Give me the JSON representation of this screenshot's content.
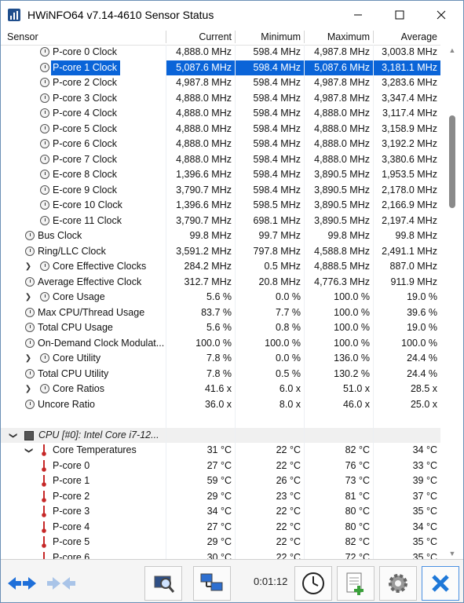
{
  "window": {
    "title": "HWiNFO64 v7.14-4610 Sensor Status"
  },
  "header": {
    "sensor": "Sensor",
    "current": "Current",
    "minimum": "Minimum",
    "maximum": "Maximum",
    "average": "Average"
  },
  "rows": [
    {
      "name": "P-core 0 Clock",
      "cur": "4,888.0 MHz",
      "min": "598.4 MHz",
      "max": "4,987.8 MHz",
      "avg": "3,003.8 MHz"
    },
    {
      "name": "P-core 1 Clock",
      "cur": "5,087.6 MHz",
      "min": "598.4 MHz",
      "max": "5,087.6 MHz",
      "avg": "3,181.1 MHz"
    },
    {
      "name": "P-core 2 Clock",
      "cur": "4,987.8 MHz",
      "min": "598.4 MHz",
      "max": "4,987.8 MHz",
      "avg": "3,283.6 MHz"
    },
    {
      "name": "P-core 3 Clock",
      "cur": "4,888.0 MHz",
      "min": "598.4 MHz",
      "max": "4,987.8 MHz",
      "avg": "3,347.4 MHz"
    },
    {
      "name": "P-core 4 Clock",
      "cur": "4,888.0 MHz",
      "min": "598.4 MHz",
      "max": "4,888.0 MHz",
      "avg": "3,117.4 MHz"
    },
    {
      "name": "P-core 5 Clock",
      "cur": "4,888.0 MHz",
      "min": "598.4 MHz",
      "max": "4,888.0 MHz",
      "avg": "3,158.9 MHz"
    },
    {
      "name": "P-core 6 Clock",
      "cur": "4,888.0 MHz",
      "min": "598.4 MHz",
      "max": "4,888.0 MHz",
      "avg": "3,192.2 MHz"
    },
    {
      "name": "P-core 7 Clock",
      "cur": "4,888.0 MHz",
      "min": "598.4 MHz",
      "max": "4,888.0 MHz",
      "avg": "3,380.6 MHz"
    },
    {
      "name": "E-core 8 Clock",
      "cur": "1,396.6 MHz",
      "min": "598.4 MHz",
      "max": "3,890.5 MHz",
      "avg": "1,953.5 MHz"
    },
    {
      "name": "E-core 9 Clock",
      "cur": "3,790.7 MHz",
      "min": "598.4 MHz",
      "max": "3,890.5 MHz",
      "avg": "2,178.0 MHz"
    },
    {
      "name": "E-core 10 Clock",
      "cur": "1,396.6 MHz",
      "min": "598.5 MHz",
      "max": "3,890.5 MHz",
      "avg": "2,166.9 MHz"
    },
    {
      "name": "E-core 11 Clock",
      "cur": "3,790.7 MHz",
      "min": "698.1 MHz",
      "max": "3,890.5 MHz",
      "avg": "2,197.4 MHz"
    },
    {
      "name": "Bus Clock",
      "cur": "99.8 MHz",
      "min": "99.7 MHz",
      "max": "99.8 MHz",
      "avg": "99.8 MHz"
    },
    {
      "name": "Ring/LLC Clock",
      "cur": "3,591.2 MHz",
      "min": "797.8 MHz",
      "max": "4,588.8 MHz",
      "avg": "2,491.1 MHz"
    },
    {
      "name": "Core Effective Clocks",
      "cur": "284.2 MHz",
      "min": "0.5 MHz",
      "max": "4,888.5 MHz",
      "avg": "887.0 MHz"
    },
    {
      "name": "Average Effective Clock",
      "cur": "312.7 MHz",
      "min": "20.8 MHz",
      "max": "4,776.3 MHz",
      "avg": "911.9 MHz"
    },
    {
      "name": "Core Usage",
      "cur": "5.6 %",
      "min": "0.0 %",
      "max": "100.0 %",
      "avg": "19.0 %"
    },
    {
      "name": "Max CPU/Thread Usage",
      "cur": "83.7 %",
      "min": "7.7 %",
      "max": "100.0 %",
      "avg": "39.6 %"
    },
    {
      "name": "Total CPU Usage",
      "cur": "5.6 %",
      "min": "0.8 %",
      "max": "100.0 %",
      "avg": "19.0 %"
    },
    {
      "name": "On-Demand Clock Modulat...",
      "cur": "100.0 %",
      "min": "100.0 %",
      "max": "100.0 %",
      "avg": "100.0 %"
    },
    {
      "name": "Core Utility",
      "cur": "7.8 %",
      "min": "0.0 %",
      "max": "136.0 %",
      "avg": "24.4 %"
    },
    {
      "name": "Total CPU Utility",
      "cur": "7.8 %",
      "min": "0.5 %",
      "max": "130.2 %",
      "avg": "24.4 %"
    },
    {
      "name": "Core Ratios",
      "cur": "41.6 x",
      "min": "6.0 x",
      "max": "51.0 x",
      "avg": "28.5 x"
    },
    {
      "name": "Uncore Ratio",
      "cur": "36.0 x",
      "min": "8.0 x",
      "max": "46.0 x",
      "avg": "25.0 x"
    },
    {
      "name": "",
      "cur": "",
      "min": "",
      "max": "",
      "avg": ""
    },
    {
      "name": "CPU [#0]: Intel Core i7-12...",
      "cur": "",
      "min": "",
      "max": "",
      "avg": ""
    },
    {
      "name": "Core Temperatures",
      "cur": "31 °C",
      "min": "22 °C",
      "max": "82 °C",
      "avg": "34 °C"
    },
    {
      "name": "P-core 0",
      "cur": "27 °C",
      "min": "22 °C",
      "max": "76 °C",
      "avg": "33 °C"
    },
    {
      "name": "P-core 1",
      "cur": "59 °C",
      "min": "26 °C",
      "max": "73 °C",
      "avg": "39 °C"
    },
    {
      "name": "P-core 2",
      "cur": "29 °C",
      "min": "23 °C",
      "max": "81 °C",
      "avg": "37 °C"
    },
    {
      "name": "P-core 3",
      "cur": "34 °C",
      "min": "22 °C",
      "max": "80 °C",
      "avg": "35 °C"
    },
    {
      "name": "P-core 4",
      "cur": "27 °C",
      "min": "22 °C",
      "max": "80 °C",
      "avg": "34 °C"
    },
    {
      "name": "P-core 5",
      "cur": "29 °C",
      "min": "22 °C",
      "max": "82 °C",
      "avg": "35 °C"
    },
    {
      "name": "P-core 6",
      "cur": "30 °C",
      "min": "22 °C",
      "max": "72 °C",
      "avg": "35 °C"
    }
  ],
  "toolbar": {
    "timer": "0:01:12"
  }
}
